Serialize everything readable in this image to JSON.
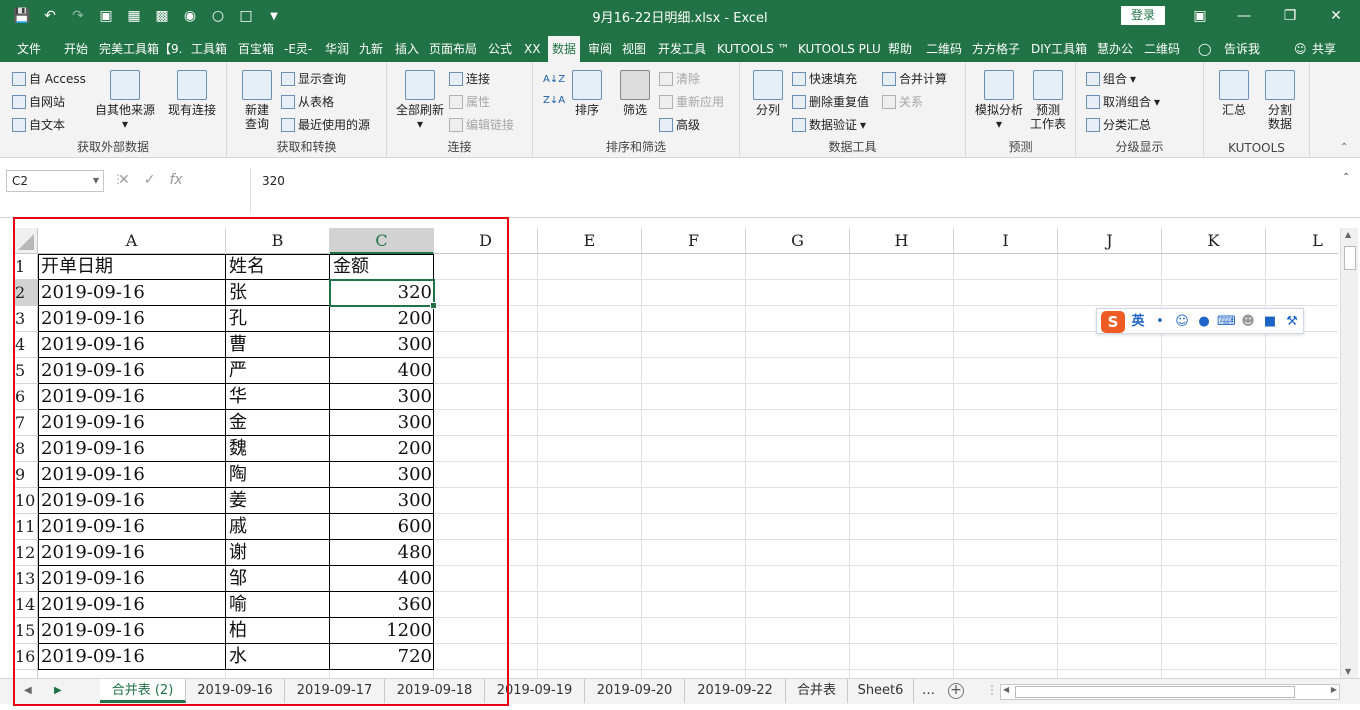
{
  "window": {
    "title": "9月16-22日明细.xlsx  -  Excel",
    "login": "登录"
  },
  "tabs": [
    "文件",
    "开始",
    "完美工具箱【9.",
    "工具箱",
    "百宝箱",
    "-E灵-",
    "华润",
    "九新",
    "插入",
    "页面布局",
    "公式",
    "XX",
    "数据",
    "审阅",
    "视图",
    "开发工具",
    "KUTOOLS ™",
    "KUTOOLS PLU",
    "帮助",
    "二维码",
    "方方格子",
    "DIY工具箱",
    "慧办公",
    "二维码"
  ],
  "tell_me": "告诉我",
  "share": "共享",
  "ribbon": {
    "get_external": {
      "label": "获取外部数据",
      "access": "自 Access",
      "web": "自网站",
      "text": "自文本",
      "other": "自其他来源",
      "existing": "现有连接"
    },
    "get_transform": {
      "label": "获取和转换",
      "new_query": "新建\n查询",
      "show_query": "显示查询",
      "from_table": "从表格",
      "recent": "最近使用的源"
    },
    "connections": {
      "label": "连接",
      "refresh_all": "全部刷新",
      "connections": "连接",
      "properties": "属性",
      "edit_links": "编辑链接"
    },
    "sort_filter": {
      "label": "排序和筛选",
      "sort": "排序",
      "filter": "筛选",
      "clear": "清除",
      "reapply": "重新应用",
      "advanced": "高级"
    },
    "data_tools": {
      "label": "数据工具",
      "text_to_columns": "分列",
      "flash_fill": "快速填充",
      "remove_dup": "删除重复值",
      "validation": "数据验证",
      "consolidate": "合并计算",
      "relationships": "关系"
    },
    "forecast": {
      "label": "预测",
      "what_if": "模拟分析",
      "forecast_sheet": "预测\n工作表"
    },
    "outline": {
      "label": "分级显示",
      "group": "组合",
      "ungroup": "取消组合",
      "subtotal": "分类汇总"
    },
    "kutools": {
      "label": "KUTOOLS",
      "summary": "汇总",
      "split": "分割\n数据"
    }
  },
  "formula_bar": {
    "name_box": "C2",
    "value": "320",
    "fx": "fx"
  },
  "columns": [
    "A",
    "B",
    "C",
    "D",
    "E",
    "F",
    "G",
    "H",
    "I",
    "J",
    "K",
    "L"
  ],
  "rows": [
    {
      "num": "1",
      "a": "开单日期",
      "b": "姓名",
      "c": "金额"
    },
    {
      "num": "2",
      "a": "2019-09-16",
      "b": "张",
      "c": "320"
    },
    {
      "num": "3",
      "a": "2019-09-16",
      "b": "孔",
      "c": "200"
    },
    {
      "num": "4",
      "a": "2019-09-16",
      "b": "曹",
      "c": "300"
    },
    {
      "num": "5",
      "a": "2019-09-16",
      "b": "严",
      "c": "400"
    },
    {
      "num": "6",
      "a": "2019-09-16",
      "b": "华",
      "c": "300"
    },
    {
      "num": "7",
      "a": "2019-09-16",
      "b": "金",
      "c": "300"
    },
    {
      "num": "8",
      "a": "2019-09-16",
      "b": "魏",
      "c": "200"
    },
    {
      "num": "9",
      "a": "2019-09-16",
      "b": "陶",
      "c": "300"
    },
    {
      "num": "10",
      "a": "2019-09-16",
      "b": "姜",
      "c": "300"
    },
    {
      "num": "11",
      "a": "2019-09-16",
      "b": "戚",
      "c": "600"
    },
    {
      "num": "12",
      "a": "2019-09-16",
      "b": "谢",
      "c": "480"
    },
    {
      "num": "13",
      "a": "2019-09-16",
      "b": "邹",
      "c": "400"
    },
    {
      "num": "14",
      "a": "2019-09-16",
      "b": "喻",
      "c": "360"
    },
    {
      "num": "15",
      "a": "2019-09-16",
      "b": "柏",
      "c": "1200"
    },
    {
      "num": "16",
      "a": "2019-09-16",
      "b": "水",
      "c": "720"
    }
  ],
  "sheets": [
    "合并表 (2)",
    "2019-09-16",
    "2019-09-17",
    "2019-09-18",
    "2019-09-19",
    "2019-09-20",
    "2019-09-22",
    "合并表",
    "Sheet6"
  ],
  "ime": {
    "logo": "S",
    "lang": "英"
  },
  "colors": {
    "accent": "#217346",
    "highlight": "#e60012"
  }
}
